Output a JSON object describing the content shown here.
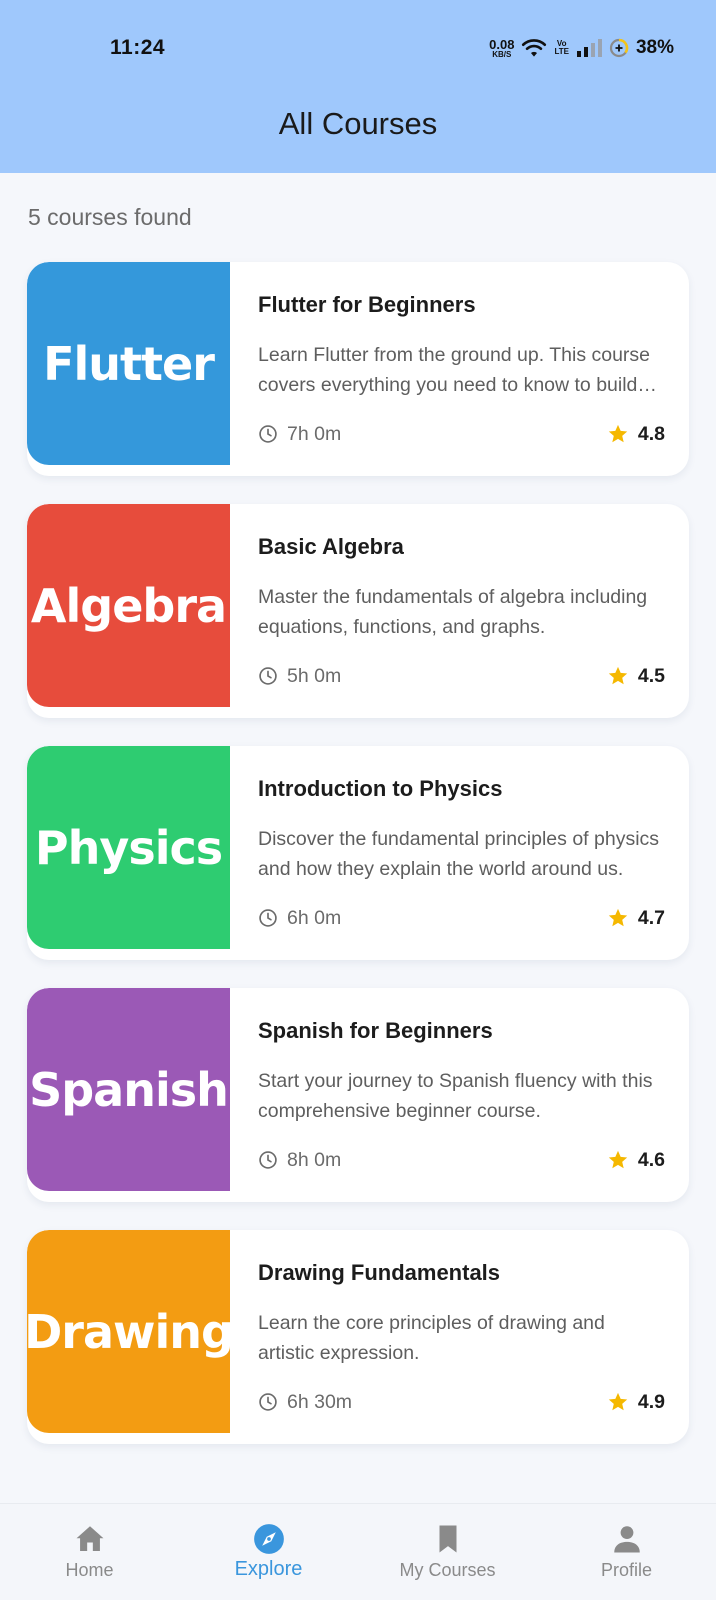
{
  "status_bar": {
    "time": "11:24",
    "net_speed": "0.08",
    "net_unit": "KB/S",
    "volte_top": "Vo",
    "volte_bottom": "LTE",
    "battery": "38%"
  },
  "header": {
    "title": "All Courses"
  },
  "results": {
    "count_text": "5 courses found"
  },
  "courses": [
    {
      "thumb_label": "Flutter",
      "thumb_color": "#3498db",
      "title": "Flutter for Beginners",
      "description": "Learn Flutter from the ground up. This course covers everything you need to know to build beautiful apps.",
      "duration": "7h 0m",
      "rating": "4.8"
    },
    {
      "thumb_label": "Algebra",
      "thumb_color": "#e74c3c",
      "title": "Basic Algebra",
      "description": "Master the fundamentals of algebra including equations, functions, and graphs.",
      "duration": "5h 0m",
      "rating": "4.5"
    },
    {
      "thumb_label": "Physics",
      "thumb_color": "#2ecc71",
      "title": "Introduction to Physics",
      "description": "Discover the fundamental principles of physics and how they explain the world around us.",
      "duration": "6h 0m",
      "rating": "4.7"
    },
    {
      "thumb_label": "Spanish",
      "thumb_color": "#9b59b6",
      "title": "Spanish for Beginners",
      "description": "Start your journey to Spanish fluency with this comprehensive beginner course.",
      "duration": "8h 0m",
      "rating": "4.6"
    },
    {
      "thumb_label": "Drawing",
      "thumb_color": "#f39c12",
      "title": "Drawing Fundamentals",
      "description": "Learn the core principles of drawing and artistic expression.",
      "duration": "6h 30m",
      "rating": "4.9"
    }
  ],
  "nav": [
    {
      "label": "Home",
      "icon": "home-icon",
      "active": false
    },
    {
      "label": "Explore",
      "icon": "compass-icon",
      "active": true
    },
    {
      "label": "My Courses",
      "icon": "bookmark-icon",
      "active": false
    },
    {
      "label": "Profile",
      "icon": "person-icon",
      "active": false
    }
  ],
  "colors": {
    "header_bg": "#9fc8fc",
    "accent": "#3a96dd",
    "star": "#f5b800",
    "nav_inactive": "#8a8a8a"
  }
}
